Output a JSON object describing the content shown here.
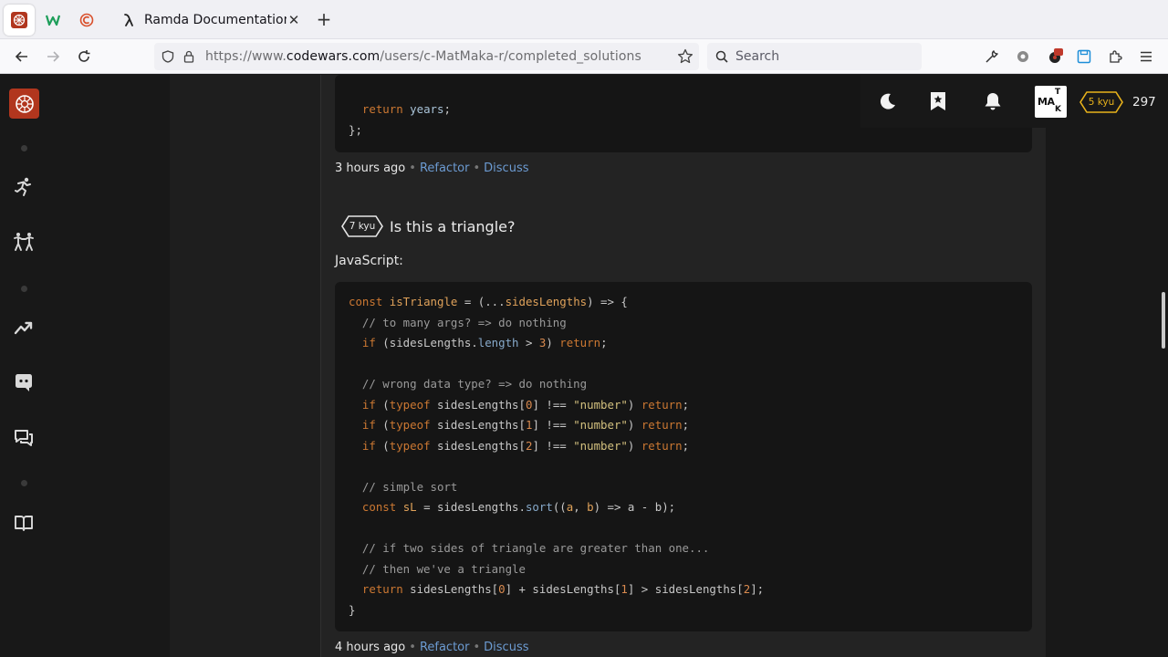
{
  "browser": {
    "active_tab_title": "Ramda Documentation",
    "url_prefix": "https://www.",
    "url_host": "codewars.com",
    "url_path": "/users/c-MatMaka-r/completed_solutions",
    "search_placeholder": "Search",
    "new_tab_symbol": "+",
    "close_tab_symbol": "✕"
  },
  "topbar": {
    "avatar_letters": {
      "top": "T",
      "middle": "MA",
      "bottom": "K"
    },
    "user_rank": "5 kyu",
    "honor": "297"
  },
  "previous_solution": {
    "code_lines": [
      [
        {
          "t": "  ",
          "c": "plain"
        },
        {
          "t": "return",
          "c": "kw"
        },
        {
          "t": " years",
          "c": "ident"
        },
        {
          "t": ";",
          "c": "plain"
        }
      ],
      [
        {
          "t": "};",
          "c": "plain"
        }
      ]
    ],
    "time": "3 hours ago",
    "refactor": "Refactor",
    "discuss": "Discuss",
    "separator": "•"
  },
  "kata": {
    "rank": "7 kyu",
    "title": "Is this a triangle?",
    "language": "JavaScript:",
    "code_lines": [
      [
        {
          "t": "const ",
          "c": "kw"
        },
        {
          "t": "isTriangle",
          "c": "fn"
        },
        {
          "t": " = (...",
          "c": "plain"
        },
        {
          "t": "sidesLengths",
          "c": "fn"
        },
        {
          "t": ") => {",
          "c": "plain"
        }
      ],
      [
        {
          "t": "  // to many args? => do nothing",
          "c": "cm"
        }
      ],
      [
        {
          "t": "  ",
          "c": "plain"
        },
        {
          "t": "if",
          "c": "kw"
        },
        {
          "t": " (sidesLengths.",
          "c": "plain"
        },
        {
          "t": "length",
          "c": "prop"
        },
        {
          "t": " > ",
          "c": "plain"
        },
        {
          "t": "3",
          "c": "num"
        },
        {
          "t": ") ",
          "c": "plain"
        },
        {
          "t": "return",
          "c": "kw"
        },
        {
          "t": ";",
          "c": "plain"
        }
      ],
      [],
      [
        {
          "t": "  // wrong data type? => do nothing",
          "c": "cm"
        }
      ],
      [
        {
          "t": "  ",
          "c": "plain"
        },
        {
          "t": "if",
          "c": "kw"
        },
        {
          "t": " (",
          "c": "plain"
        },
        {
          "t": "typeof",
          "c": "kw"
        },
        {
          "t": " sidesLengths[",
          "c": "plain"
        },
        {
          "t": "0",
          "c": "num"
        },
        {
          "t": "] !== ",
          "c": "plain"
        },
        {
          "t": "\"number\"",
          "c": "str"
        },
        {
          "t": ") ",
          "c": "plain"
        },
        {
          "t": "return",
          "c": "kw"
        },
        {
          "t": ";",
          "c": "plain"
        }
      ],
      [
        {
          "t": "  ",
          "c": "plain"
        },
        {
          "t": "if",
          "c": "kw"
        },
        {
          "t": " (",
          "c": "plain"
        },
        {
          "t": "typeof",
          "c": "kw"
        },
        {
          "t": " sidesLengths[",
          "c": "plain"
        },
        {
          "t": "1",
          "c": "num"
        },
        {
          "t": "] !== ",
          "c": "plain"
        },
        {
          "t": "\"number\"",
          "c": "str"
        },
        {
          "t": ") ",
          "c": "plain"
        },
        {
          "t": "return",
          "c": "kw"
        },
        {
          "t": ";",
          "c": "plain"
        }
      ],
      [
        {
          "t": "  ",
          "c": "plain"
        },
        {
          "t": "if",
          "c": "kw"
        },
        {
          "t": " (",
          "c": "plain"
        },
        {
          "t": "typeof",
          "c": "kw"
        },
        {
          "t": " sidesLengths[",
          "c": "plain"
        },
        {
          "t": "2",
          "c": "num"
        },
        {
          "t": "] !== ",
          "c": "plain"
        },
        {
          "t": "\"number\"",
          "c": "str"
        },
        {
          "t": ") ",
          "c": "plain"
        },
        {
          "t": "return",
          "c": "kw"
        },
        {
          "t": ";",
          "c": "plain"
        }
      ],
      [],
      [
        {
          "t": "  // simple sort",
          "c": "cm"
        }
      ],
      [
        {
          "t": "  ",
          "c": "plain"
        },
        {
          "t": "const ",
          "c": "kw"
        },
        {
          "t": "sL",
          "c": "fn"
        },
        {
          "t": " = sidesLengths.",
          "c": "plain"
        },
        {
          "t": "sort",
          "c": "prop"
        },
        {
          "t": "((",
          "c": "plain"
        },
        {
          "t": "a",
          "c": "fn"
        },
        {
          "t": ", ",
          "c": "plain"
        },
        {
          "t": "b",
          "c": "fn"
        },
        {
          "t": ") => a - b);",
          "c": "plain"
        }
      ],
      [],
      [
        {
          "t": "  // if two sides of triangle are greater than one...",
          "c": "cm"
        }
      ],
      [
        {
          "t": "  // then we've a triangle",
          "c": "cm"
        }
      ],
      [
        {
          "t": "  ",
          "c": "plain"
        },
        {
          "t": "return",
          "c": "kw"
        },
        {
          "t": " sidesLengths[",
          "c": "plain"
        },
        {
          "t": "0",
          "c": "num"
        },
        {
          "t": "] + sidesLengths[",
          "c": "plain"
        },
        {
          "t": "1",
          "c": "num"
        },
        {
          "t": "] > sidesLengths[",
          "c": "plain"
        },
        {
          "t": "2",
          "c": "num"
        },
        {
          "t": "];",
          "c": "plain"
        }
      ],
      [
        {
          "t": "}",
          "c": "plain"
        }
      ]
    ],
    "time": "4 hours ago",
    "refactor": "Refactor",
    "discuss": "Discuss",
    "separator": "•"
  },
  "colors": {
    "brand": "#b1361e",
    "rank_badge_user": "#e8b21b",
    "link": "#6c9bd2"
  }
}
